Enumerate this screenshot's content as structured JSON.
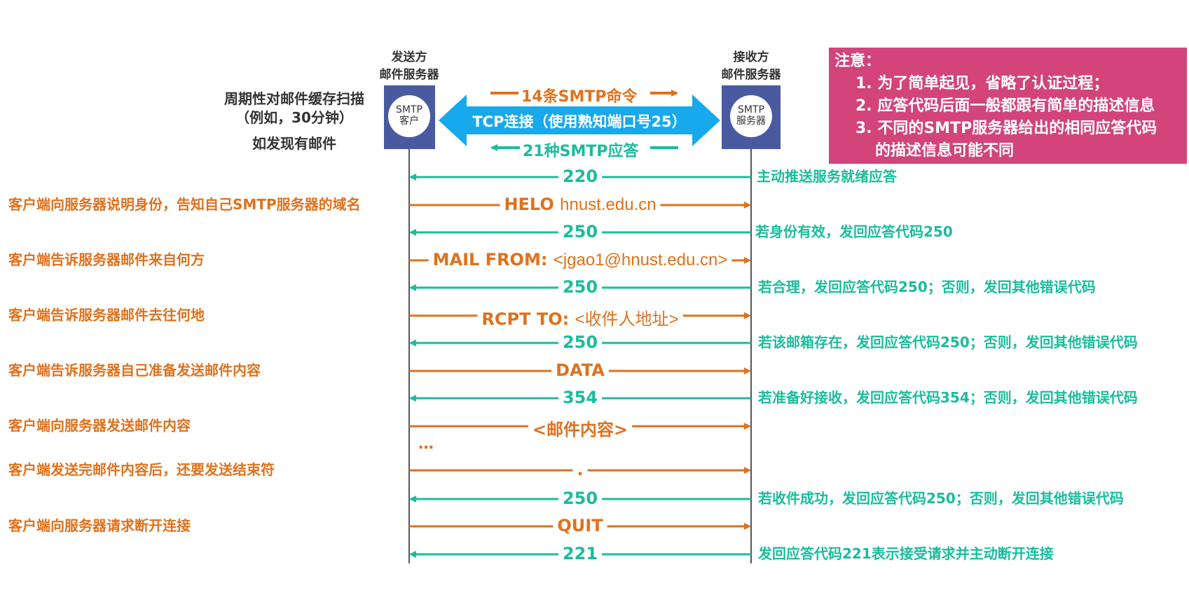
{
  "sender": {
    "title_line1": "发送方",
    "title_line2": "邮件服务器",
    "box_line1": "SMTP",
    "box_line2": "客户"
  },
  "receiver": {
    "title_line1": "接收方",
    "title_line2": "邮件服务器",
    "box_line1": "SMTP",
    "box_line2": "服务器"
  },
  "scan": {
    "line1": "周期性对邮件缓存扫描",
    "line2": "（例如，30分钟）",
    "line3": "如发现有邮件"
  },
  "tcp": {
    "commands_label": "14条SMTP命令",
    "connection_label": "TCP连接（使用熟知端口号25）",
    "replies_label": "21种SMTP应答"
  },
  "notes": {
    "title": "注意：",
    "item1": "1. 为了简单起见，省略了认证过程；",
    "item2": "2. 应答代码后面一般都跟有简单的描述信息",
    "item3": "3. 不同的SMTP服务器给出的相同应答代码",
    "item3_cont": "的描述信息可能不同"
  },
  "colors": {
    "command": "#e0711c",
    "reply": "#1abc9c",
    "tcp_arrow": "#17a9ec",
    "server_box": "#4a5aa0",
    "note_bg": "#d2447a"
  },
  "messages": [
    {
      "direction": "reply",
      "label": "220",
      "left_desc": "",
      "right_desc": "主动推送服务就绪应答"
    },
    {
      "direction": "command",
      "keyword": "HELO",
      "arg": "hnust.edu.cn",
      "left_desc": "客户端向服务器说明身份，告知自己SMTP服务器的域名",
      "right_desc": ""
    },
    {
      "direction": "reply",
      "label": "250",
      "left_desc": "",
      "right_desc": "若身份有效，发回应答代码250"
    },
    {
      "direction": "command",
      "keyword": "MAIL FROM:",
      "arg": "<jgao1@hnust.edu.cn>",
      "left_desc": "客户端告诉服务器邮件来自何方",
      "right_desc": ""
    },
    {
      "direction": "reply",
      "label": "250",
      "left_desc": "",
      "right_desc": "若合理，发回应答代码250；否则，发回其他错误代码"
    },
    {
      "direction": "command",
      "keyword": "RCPT TO:",
      "arg": "<收件人地址>",
      "left_desc": "客户端告诉服务器邮件去往何地",
      "right_desc": ""
    },
    {
      "direction": "reply",
      "label": "250",
      "left_desc": "",
      "right_desc": "若该邮箱存在，发回应答代码250；否则，发回其他错误代码"
    },
    {
      "direction": "command",
      "keyword": "DATA",
      "arg": "",
      "left_desc": "客户端告诉服务器自己准备发送邮件内容",
      "right_desc": ""
    },
    {
      "direction": "reply",
      "label": "354",
      "left_desc": "",
      "right_desc": "若准备好接收，发回应答代码354；否则，发回其他错误代码"
    },
    {
      "direction": "command",
      "keyword": "<邮件内容>",
      "arg": "",
      "left_desc": "客户端向服务器发送邮件内容",
      "right_desc": ""
    },
    {
      "direction": "command",
      "keyword": ".",
      "arg": "",
      "left_desc": "客户端发送完邮件内容后，还要发送结束符",
      "right_desc": ""
    },
    {
      "direction": "reply",
      "label": "250",
      "left_desc": "",
      "right_desc": "若收件成功，发回应答代码250；否则，发回其他错误代码"
    },
    {
      "direction": "command",
      "keyword": "QUIT",
      "arg": "",
      "left_desc": "客户端向服务器请求断开连接",
      "right_desc": ""
    },
    {
      "direction": "reply",
      "label": "221",
      "left_desc": "",
      "right_desc": "发回应答代码221表示接受请求并主动断开连接"
    }
  ],
  "ellipsis": "…"
}
